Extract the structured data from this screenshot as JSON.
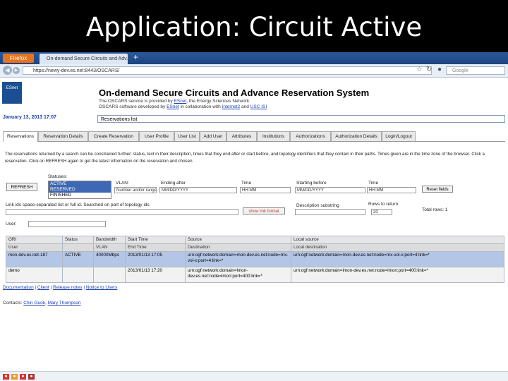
{
  "slide": {
    "title": "Application: Circuit Active"
  },
  "browser": {
    "app_button": "Firefox",
    "tab_title": "On-demand Secure Circuits and Adv...",
    "newtab_icon": "+",
    "url": "https://newy-dev.es.net:8443/OSCARS/",
    "search_placeholder": "Google"
  },
  "app": {
    "logo_text": "ESnet",
    "title": "On-demand Secure Circuits and Advance Reservation System",
    "subtitle1_a": "The OSCARS service is provided by ",
    "subtitle1_link": "ESnet",
    "subtitle1_b": ", the Energy Sciences Network",
    "subtitle2_a": "OSCARS software developed by ",
    "subtitle2_link1": "ESnet",
    "subtitle2_b": " in collaboration with ",
    "subtitle2_link2": "Internet2",
    "subtitle2_c": " and ",
    "subtitle2_link3": "USC ISI",
    "date": "January 13, 2013 17:07",
    "system_message": "Reservations list"
  },
  "tabs": [
    "Reservations",
    "Reservation Details",
    "Create Reservation",
    "User Profile",
    "User List",
    "Add User",
    "Attributes",
    "Institutions",
    "Authorizations",
    "Authorization Details",
    "Login/Logout"
  ],
  "description": "The reservations returned by a search can be constrained further: status, text in their description, times that they end after or start before, and topology identifiers that they contain in their paths. Times given are in the time zone of the browser. Click a reservation. Click on REFRESH again to get the latest information on the reservation and chosen.",
  "filters": {
    "refresh_label": "REFRESH",
    "statuses_label": "Statuses:",
    "status_options": [
      "ACTIVE",
      "RESERVED",
      "FINISHED"
    ],
    "vlans_label": "VLAN:",
    "vlan_hint": "Number and/or range",
    "ending_after_label": "Ending after",
    "ending_date": "MM/DD/YYYY",
    "time_label": "Time",
    "time_value": "HH:MM",
    "starting_before_label": "Starting before",
    "starting_date": "MM/DD/YYYY",
    "time2_label": "Time",
    "time2_value": "HH:MM",
    "reset_button": "Reset fields",
    "link_hint": "Link ids space-separated list or full id. Searched on part of topology ids",
    "show_links_button": "show link format",
    "description_label": "Description substring",
    "rows_label": "Rows to return",
    "rows_value": "20",
    "total_label": "Total rows: 1",
    "user_label": "User:"
  },
  "table": {
    "headers": [
      "GRI",
      "Status",
      "Bandwidth",
      "Start Time",
      "Source",
      "Local source"
    ],
    "subheaders": [
      "User",
      "",
      "VLAN",
      "End Time",
      "Destination",
      "Local destination"
    ],
    "rows": [
      {
        "gri": "mon-dev.es.net-187",
        "status": "ACTIVE",
        "bandwidth": "40000Mbps",
        "start": "2013/01/13 17:05",
        "source": "urn:ogf:network:domain=mon-dev.es.net:node=mx-vol-x:port=4:link=*",
        "local_source": "urn:ogf:network:domain=mon-dev.es.net:node=mx-vol-x:port=4:link=*"
      },
      {
        "gri": "demo",
        "status": "",
        "bandwidth": "",
        "start": "2013/01/13 17:20",
        "source": "urn:ogf:network:domain=lmon-dev.es.net:node=lmon:port=400:link=*",
        "local_source": "urn:ogf:network:domain=lmon-dev.es.net:node=lmon:port=400:link=*"
      }
    ]
  },
  "footer": {
    "links": [
      "Documentation",
      "Client",
      "Release notes",
      "Notice to Users"
    ],
    "contacts_label": "Contacts:",
    "contact1": "Chin Guok",
    "contact2": "Mary Thompson"
  }
}
